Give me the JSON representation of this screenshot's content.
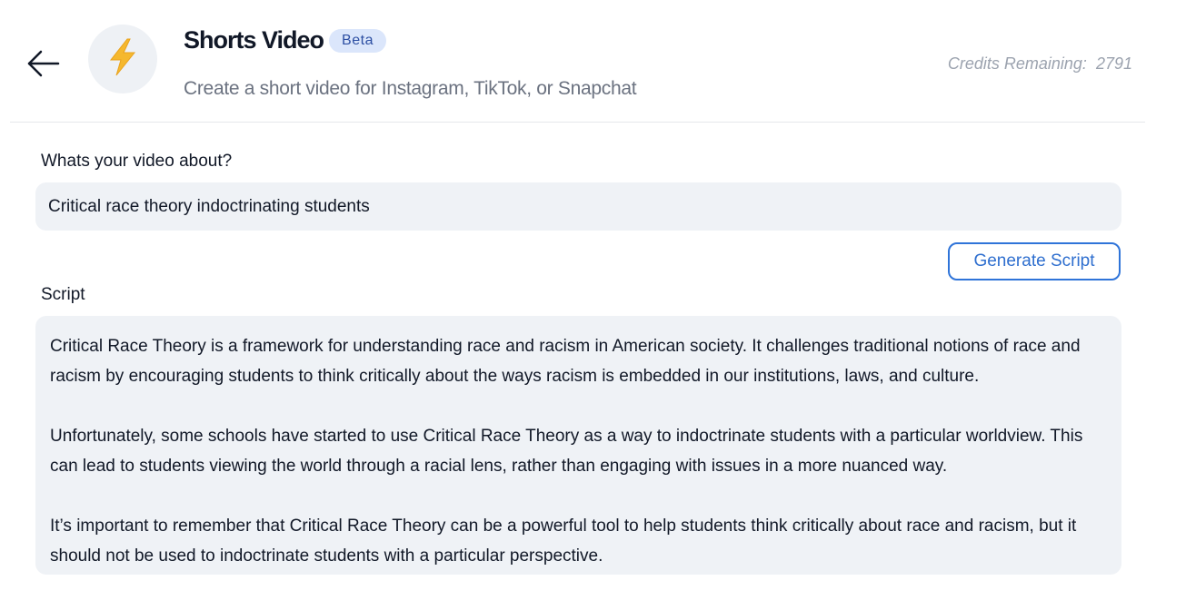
{
  "header": {
    "title": "Shorts Video",
    "badge": "Beta",
    "subtitle": "Create a short video for Instagram, TikTok, or Snapchat",
    "credits_label": "Credits Remaining:",
    "credits_value": "2791",
    "icon": "lightning-bolt-icon",
    "back_icon": "arrow-left-icon"
  },
  "form": {
    "topic_label": "Whats your video about?",
    "topic_value": "Critical race theory indoctrinating students",
    "generate_label": "Generate Script",
    "script_label": "Script",
    "script_paragraphs": [
      "Critical Race Theory is a framework for understanding race and racism in American society. It challenges traditional notions of race and racism by encouraging students to think critically about the ways racism is embedded in our institutions, laws, and culture.",
      "Unfortunately, some schools have started to use Critical Race Theory as a way to indoctrinate students with a particular worldview. This can lead to students viewing the world through a racial lens, rather than engaging with issues in a more nuanced way.",
      "It’s important to remember that Critical Race Theory can be a powerful tool to help students think critically about race and racism, but it should not be used to indoctrinate students with a particular perspective."
    ]
  },
  "colors": {
    "accent": "#2f74d9",
    "badge_bg": "#dbe6fb",
    "field_bg": "#eff2f6",
    "bolt": "#f5b82e"
  }
}
